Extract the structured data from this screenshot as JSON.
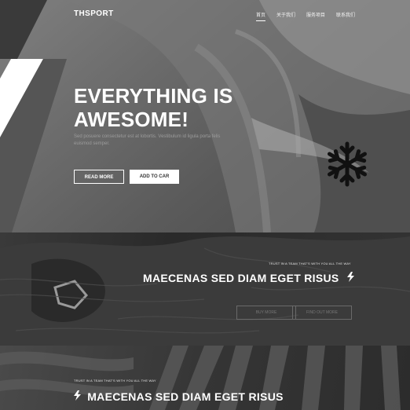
{
  "brand": {
    "logo": "THSPORT"
  },
  "nav": {
    "items": [
      {
        "label": "首页",
        "active": true
      },
      {
        "label": "关于我们",
        "active": false
      },
      {
        "label": "服务项目",
        "active": false
      },
      {
        "label": "联系我们",
        "active": false
      }
    ]
  },
  "hero": {
    "title_line1": "EVERYTHING IS",
    "title_line2": "AWESOME!",
    "subtitle": "Sed posuere consectetur est at lobortis. Vestibulum id ligula porta felis euismod semper.",
    "read_more_label": "READ MORE",
    "add_to_cart_label": "ADD TO CAR"
  },
  "section1": {
    "kicker": "TRUST IN A TEAM THAT'S WITH YOU ALL THE WAY",
    "headline": "MAECENAS SED DIAM EGET RISUS",
    "buy_label": "BUY MORE",
    "find_label": "FIND OUT MORE"
  },
  "section2": {
    "kicker": "TRUST IN A TEAM THAT'S WITH YOU ALL THE WAY",
    "headline": "MAECENAS SED DIAM EGET RISUS"
  },
  "icons": {
    "hero_icon": "snowflake-icon",
    "headline_icon": "lightning-bolt-icon"
  },
  "colors": {
    "hero_bg": "#6a6a6a",
    "band_bg": "#2f2f2f",
    "text": "#ffffff"
  }
}
